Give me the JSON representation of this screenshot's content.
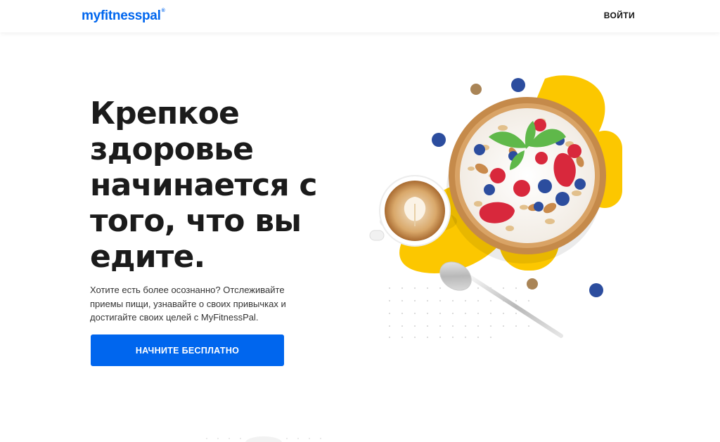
{
  "header": {
    "logo_text": "myfitnesspal",
    "logo_tm": "®",
    "login_label": "ВОЙТИ"
  },
  "hero": {
    "title": "Крепкое\nздоровье\nначинается с\nтого, что вы\nедите.",
    "description": "Хотите есть более осознанно? Отслеживайте приемы пищи, узнавайте о своих привычках и достигайте своих целей с MyFitnessPal.",
    "cta_label": "НАЧНИТЕ БЕСПЛАТНО"
  },
  "colors": {
    "brand_blue": "#0066ee",
    "accent_yellow": "#fcc700",
    "heading": "#1b1b1b"
  },
  "illustration": {
    "icons": [
      "oatmeal-bowl-icon",
      "coffee-cup-icon",
      "spoon-icon",
      "blueberry-icon",
      "walnut-icon"
    ]
  }
}
